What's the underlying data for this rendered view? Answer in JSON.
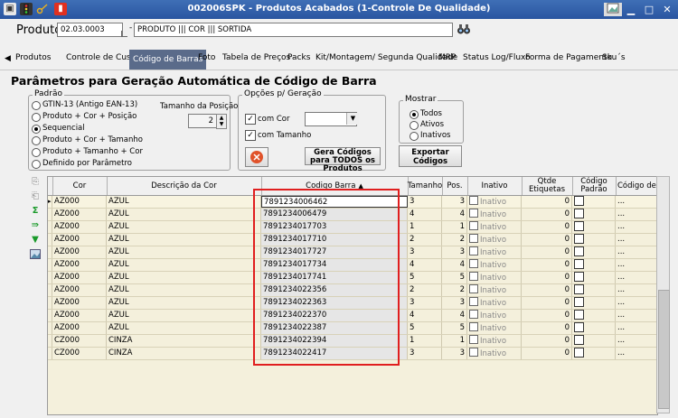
{
  "window": {
    "title": "002006SPK - Produtos Acabados (1-Controle De Qualidade)"
  },
  "colors": {
    "titlebar": "#2f5ea8",
    "tab_active": "#5a6b8a",
    "grid_bg": "#f4f0dc",
    "highlight": "#e01f1f"
  },
  "product": {
    "label": "Produto",
    "code": "02.03.0003",
    "name": "PRODUTO ||| COR ||| SORTIDA"
  },
  "tabs": [
    "Produtos",
    "Controle de Custo",
    "Código de Barras",
    "Foto",
    "Tabela de Preços",
    "Packs",
    "Kit/Montagem/ Segunda Qualidade",
    "MRP",
    "Status Log/Fluxo",
    "Forma de Pagamento",
    "Sku´s"
  ],
  "active_tab": "Código de Barras",
  "heading": "Parâmetros para Geração Automática de Código de Barra",
  "padrao": {
    "legend": "Padrão",
    "options": [
      "GTIN-13 (Antigo EAN-13)",
      "Produto + Cor + Posição",
      "Sequencial",
      "Produto + Cor + Tamanho",
      "Produto + Tamanho + Cor",
      "Definido por Parâmetro"
    ],
    "selected_index": 2,
    "size_label": "Tamanho da Posição",
    "size_value": "2"
  },
  "opcoes": {
    "legend": "Opções p/ Geração",
    "com_cor": "com Cor",
    "com_tamanho": "com Tamanho",
    "generate_button": "Gera Códigos para TODOS os Produtos"
  },
  "mostrar": {
    "legend": "Mostrar",
    "options": [
      "Todos",
      "Ativos",
      "Inativos"
    ],
    "selected_index": 0,
    "export_button": "Exportar Códigos"
  },
  "grid": {
    "columns": [
      "Cor",
      "Descrição da Cor",
      "Codigo Barra",
      "Tamanho",
      "Pos.",
      "Inativo",
      "Qtde Etiquetas",
      "Código Padrão",
      "Código de B"
    ],
    "rows": [
      {
        "cor": "AZ000",
        "desc": "AZUL",
        "barra": "7891234006462",
        "tam": "3",
        "pos": "3",
        "inativo": "Inativo",
        "qtde": "0",
        "padrao": "..."
      },
      {
        "cor": "AZ000",
        "desc": "AZUL",
        "barra": "7891234006479",
        "tam": "4",
        "pos": "4",
        "inativo": "Inativo",
        "qtde": "0",
        "padrao": "..."
      },
      {
        "cor": "AZ000",
        "desc": "AZUL",
        "barra": "7891234017703",
        "tam": "1",
        "pos": "1",
        "inativo": "Inativo",
        "qtde": "0",
        "padrao": "..."
      },
      {
        "cor": "AZ000",
        "desc": "AZUL",
        "barra": "7891234017710",
        "tam": "2",
        "pos": "2",
        "inativo": "Inativo",
        "qtde": "0",
        "padrao": "..."
      },
      {
        "cor": "AZ000",
        "desc": "AZUL",
        "barra": "7891234017727",
        "tam": "3",
        "pos": "3",
        "inativo": "Inativo",
        "qtde": "0",
        "padrao": "..."
      },
      {
        "cor": "AZ000",
        "desc": "AZUL",
        "barra": "7891234017734",
        "tam": "4",
        "pos": "4",
        "inativo": "Inativo",
        "qtde": "0",
        "padrao": "..."
      },
      {
        "cor": "AZ000",
        "desc": "AZUL",
        "barra": "7891234017741",
        "tam": "5",
        "pos": "5",
        "inativo": "Inativo",
        "qtde": "0",
        "padrao": "..."
      },
      {
        "cor": "AZ000",
        "desc": "AZUL",
        "barra": "7891234022356",
        "tam": "2",
        "pos": "2",
        "inativo": "Inativo",
        "qtde": "0",
        "padrao": "..."
      },
      {
        "cor": "AZ000",
        "desc": "AZUL",
        "barra": "7891234022363",
        "tam": "3",
        "pos": "3",
        "inativo": "Inativo",
        "qtde": "0",
        "padrao": "..."
      },
      {
        "cor": "AZ000",
        "desc": "AZUL",
        "barra": "7891234022370",
        "tam": "4",
        "pos": "4",
        "inativo": "Inativo",
        "qtde": "0",
        "padrao": "..."
      },
      {
        "cor": "AZ000",
        "desc": "AZUL",
        "barra": "7891234022387",
        "tam": "5",
        "pos": "5",
        "inativo": "Inativo",
        "qtde": "0",
        "padrao": "..."
      },
      {
        "cor": "CZ000",
        "desc": "CINZA",
        "barra": "7891234022394",
        "tam": "1",
        "pos": "1",
        "inativo": "Inativo",
        "qtde": "0",
        "padrao": "..."
      },
      {
        "cor": "CZ000",
        "desc": "CINZA",
        "barra": "7891234022417",
        "tam": "3",
        "pos": "3",
        "inativo": "Inativo",
        "qtde": "0",
        "padrao": "..."
      }
    ]
  },
  "icons": [
    "app-icon",
    "traffic-light-icon",
    "key-icon",
    "book-icon",
    "binoculars-icon",
    "image-icon",
    "minimize-icon",
    "maximize-icon",
    "close-icon",
    "tab-scroll-left-icon",
    "sigma-icon",
    "export-icon",
    "filter-icon",
    "picture-icon"
  ]
}
